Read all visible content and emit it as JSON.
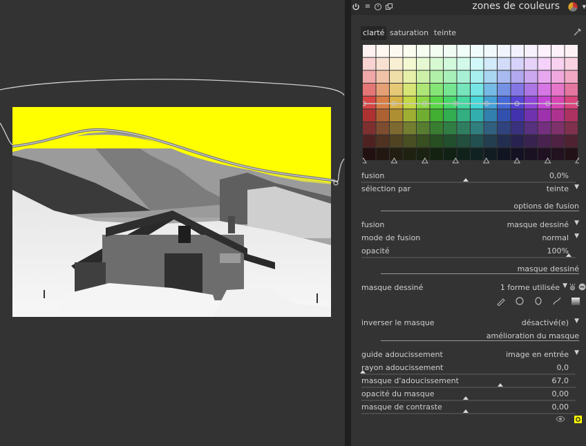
{
  "module": {
    "title": "zones de couleurs"
  },
  "tabs": [
    "clarté",
    "saturation",
    "teinte"
  ],
  "fusion_slider": {
    "label": "fusion",
    "value": "0,0%",
    "level": 0.5
  },
  "selection": {
    "label": "sélection par",
    "value": "teinte"
  },
  "section_fusion": "options de fusion",
  "blend": {
    "fusion": {
      "label": "fusion",
      "value": "masque dessiné"
    },
    "mode": {
      "label": "mode de fusion",
      "value": "normal"
    },
    "opacite": {
      "label": "opacité",
      "value": "100%",
      "level": 1.0
    }
  },
  "section_masque": "masque dessiné",
  "drawn_mask": {
    "label": "masque dessiné",
    "value": "1 forme utilisée"
  },
  "invert": {
    "label": "inverser le masque",
    "value": "désactivé(e)"
  },
  "section_amelioration": "amélioration du masque",
  "refine": {
    "guide": {
      "label": "guide adoucissement",
      "value": "image en entrée"
    },
    "rayon": {
      "label": "rayon adoucissement",
      "value": "0,0",
      "level": 0.0
    },
    "masque_adouc": {
      "label": "masque d'adoucissement",
      "value": "67,0",
      "level": 0.67
    },
    "opacite_masque": {
      "label": "opacité du masque",
      "value": "0,00",
      "level": 0.5
    },
    "contraste": {
      "label": "masque de contraste",
      "value": "0,00",
      "level": 0.5
    }
  },
  "colors": {
    "mask_overlay": "#ffff00",
    "panel_bg": "#333333"
  }
}
